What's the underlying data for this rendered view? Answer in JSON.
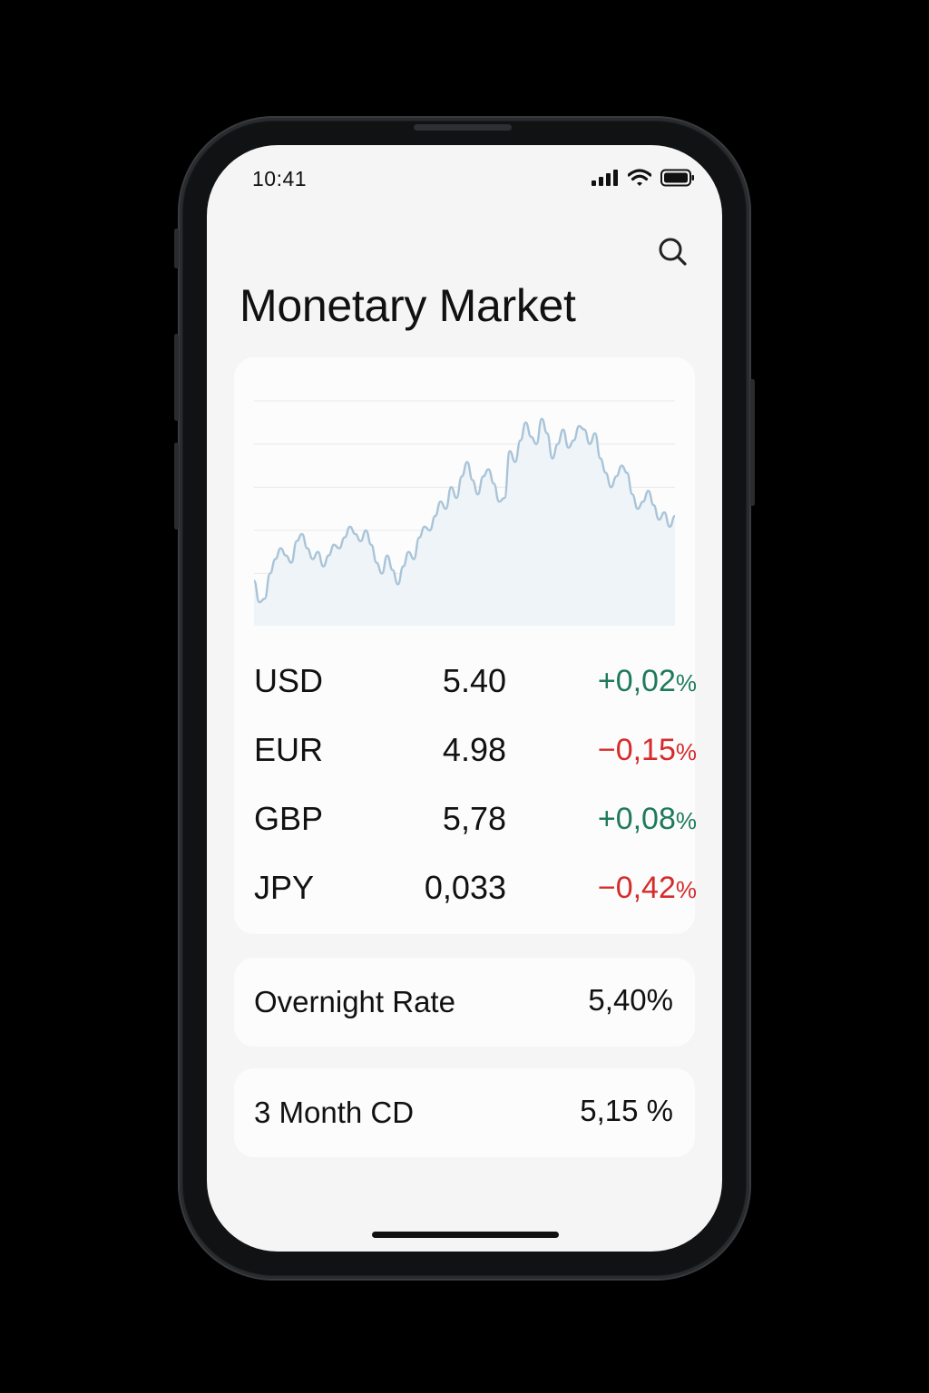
{
  "status_bar": {
    "time": "10:41"
  },
  "header": {
    "title": "Monetary Market"
  },
  "chart_data": {
    "type": "area",
    "x": [
      0,
      1,
      2,
      3,
      4,
      5,
      6,
      7,
      8,
      9,
      10,
      11,
      12,
      13,
      14,
      15,
      16,
      17,
      18,
      19,
      20,
      21,
      22,
      23,
      24,
      25,
      26,
      27,
      28,
      29,
      30,
      31,
      32,
      33,
      34,
      35,
      36,
      37,
      38,
      39,
      40,
      41,
      42,
      43,
      44,
      45,
      46,
      47,
      48,
      49,
      50,
      51,
      52,
      53,
      54,
      55,
      56,
      57,
      58,
      59,
      60,
      61,
      62,
      63,
      64,
      65,
      66,
      67,
      68,
      69,
      70,
      71,
      72,
      73,
      74,
      75,
      76,
      77,
      78,
      79
    ],
    "series": [
      {
        "values": [
          1.0,
          0.4,
          0.5,
          1.2,
          1.6,
          1.9,
          1.7,
          1.5,
          2.1,
          2.3,
          1.9,
          1.6,
          1.8,
          1.4,
          1.7,
          2.0,
          1.9,
          2.2,
          2.5,
          2.3,
          2.1,
          2.4,
          2.0,
          1.5,
          1.2,
          1.7,
          1.3,
          0.9,
          1.4,
          1.8,
          1.6,
          2.2,
          2.5,
          2.4,
          2.8,
          3.2,
          3.0,
          3.6,
          3.3,
          3.9,
          4.3,
          3.8,
          3.4,
          3.9,
          4.1,
          3.7,
          3.2,
          3.3,
          4.6,
          4.3,
          4.9,
          5.4,
          5.0,
          4.8,
          5.5,
          5.1,
          4.4,
          4.8,
          5.2,
          4.7,
          4.9,
          5.3,
          5.2,
          4.8,
          5.1,
          4.4,
          4.0,
          3.6,
          3.9,
          4.2,
          4.0,
          3.4,
          3.0,
          3.2,
          3.5,
          3.1,
          2.7,
          2.9,
          2.5,
          2.8
        ]
      }
    ],
    "grid": true,
    "legend": "none"
  },
  "rates": [
    {
      "code": "USD",
      "value": "5.40",
      "sign": "+",
      "change": "0,02",
      "unit": "%",
      "direction": "up"
    },
    {
      "code": "EUR",
      "value": "4.98",
      "sign": "−",
      "change": "0,15",
      "unit": "%",
      "direction": "down"
    },
    {
      "code": "GBP",
      "value": "5,78",
      "sign": "+",
      "change": "0,08",
      "unit": "%",
      "direction": "up"
    },
    {
      "code": "JPY",
      "value": "0,033",
      "sign": "−",
      "change": "0,42",
      "unit": "%",
      "direction": "down"
    }
  ],
  "info": [
    {
      "label": "Overnight Rate",
      "value": "5,40%"
    },
    {
      "label": "3 Month CD",
      "value": "5,15 %"
    }
  ],
  "colors": {
    "positive": "#1f7a5c",
    "negative": "#d62b2b",
    "chart_line": "#a9c4d8",
    "chart_fill": "#eef4f8"
  },
  "icons": {
    "search": "search-icon",
    "signal": "cellular-signal-icon",
    "wifi": "wifi-icon",
    "battery": "battery-icon"
  }
}
